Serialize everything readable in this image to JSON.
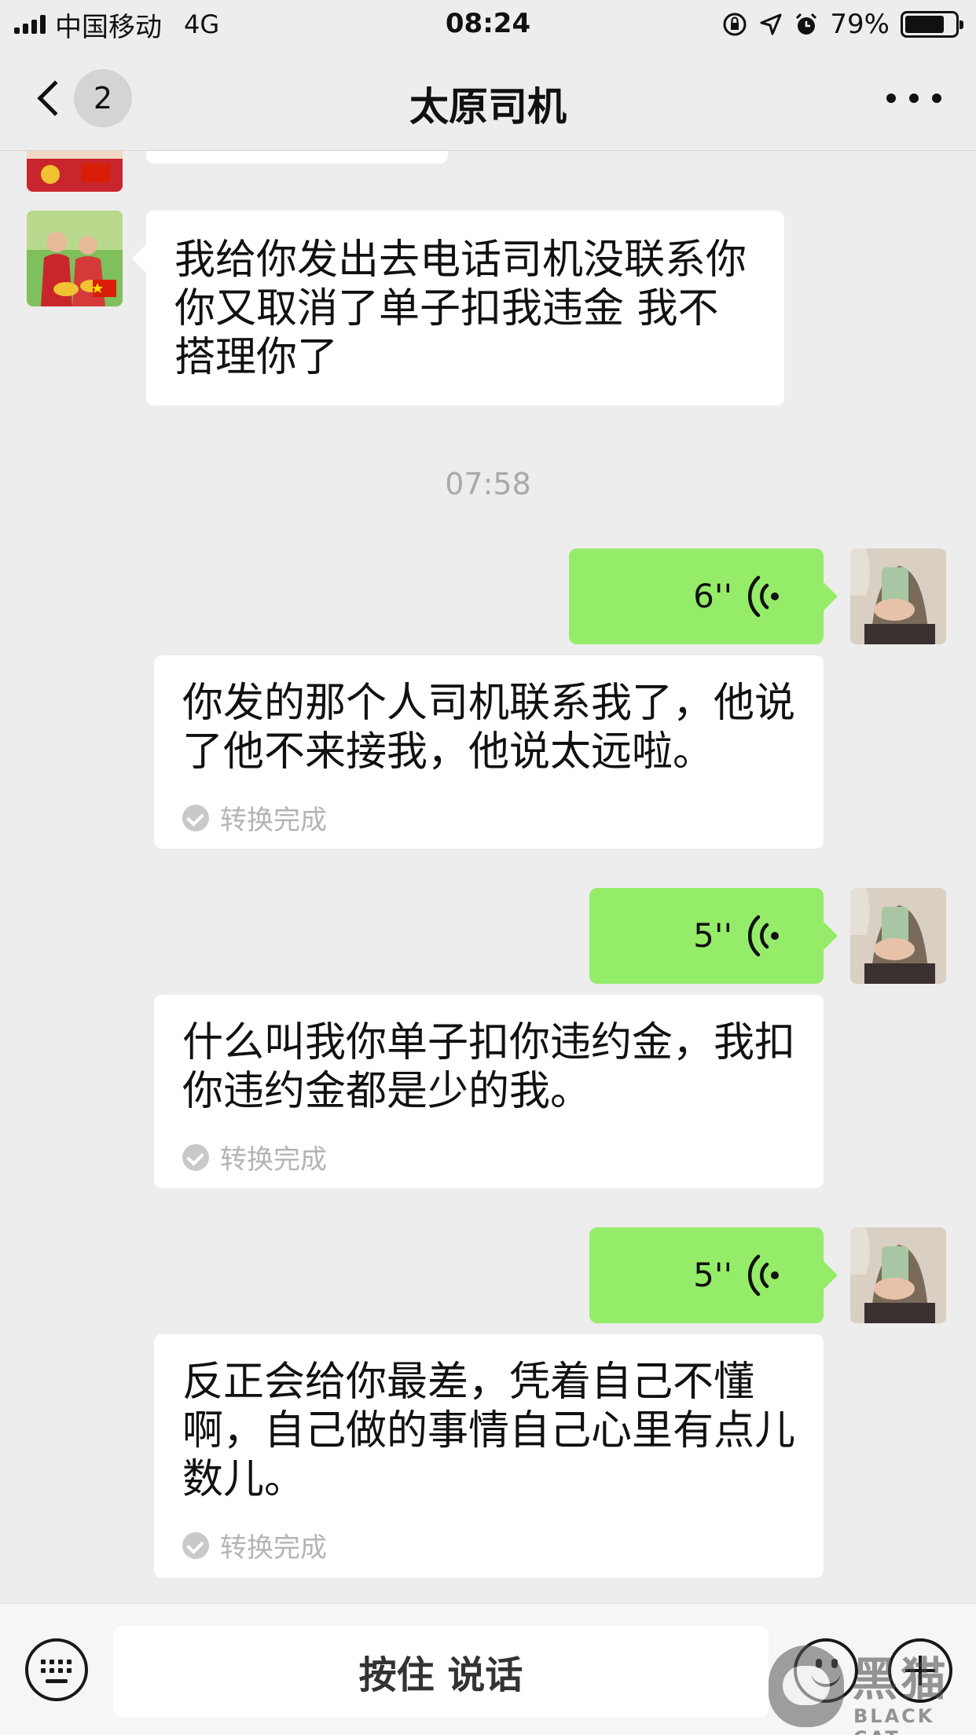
{
  "status_bar": {
    "carrier": "中国移动",
    "network": "4G",
    "time": "08:24",
    "battery": "79%",
    "battery_level": 0.79,
    "icons": [
      "signal-icon",
      "orientation-lock-icon",
      "location-arrow-icon",
      "alarm-icon",
      "battery-icon"
    ]
  },
  "nav": {
    "back_label": "back",
    "unread_count": "2",
    "title": "太原司机",
    "more_icon": "more-icon"
  },
  "messages": [
    {
      "type": "text",
      "sender": "other",
      "text": "我给你发出去电话司机没联系你你又取消了单子扣我违金 我不搭理你了"
    },
    {
      "type": "timestamp",
      "text": "07:58"
    },
    {
      "type": "voice",
      "sender": "self",
      "duration": "6''",
      "transcript": "你发的那个人司机联系我了，他说了他不来接我，他说太远啦。",
      "status": "转换完成"
    },
    {
      "type": "voice",
      "sender": "self",
      "duration": "5''",
      "transcript": "什么叫我你单子扣你违约金，我扣你违约金都是少的我。",
      "status": "转换完成"
    },
    {
      "type": "voice",
      "sender": "self",
      "duration": "5''",
      "transcript": "反正会给你最差，凭着自己不懂啊，自己做的事情自己心里有点儿数儿。",
      "status": "转换完成"
    }
  ],
  "input_bar": {
    "talk_label": "按住 说话",
    "icons": [
      "keyboard-icon",
      "emoji-icon",
      "plus-icon"
    ]
  },
  "watermark": {
    "title": "黑猫",
    "subtitle": "BLACK CAT"
  },
  "colors": {
    "background": "#ededed",
    "self_bubble": "#95ec69",
    "other_bubble": "#ffffff",
    "muted_text": "#a9a9a9"
  }
}
